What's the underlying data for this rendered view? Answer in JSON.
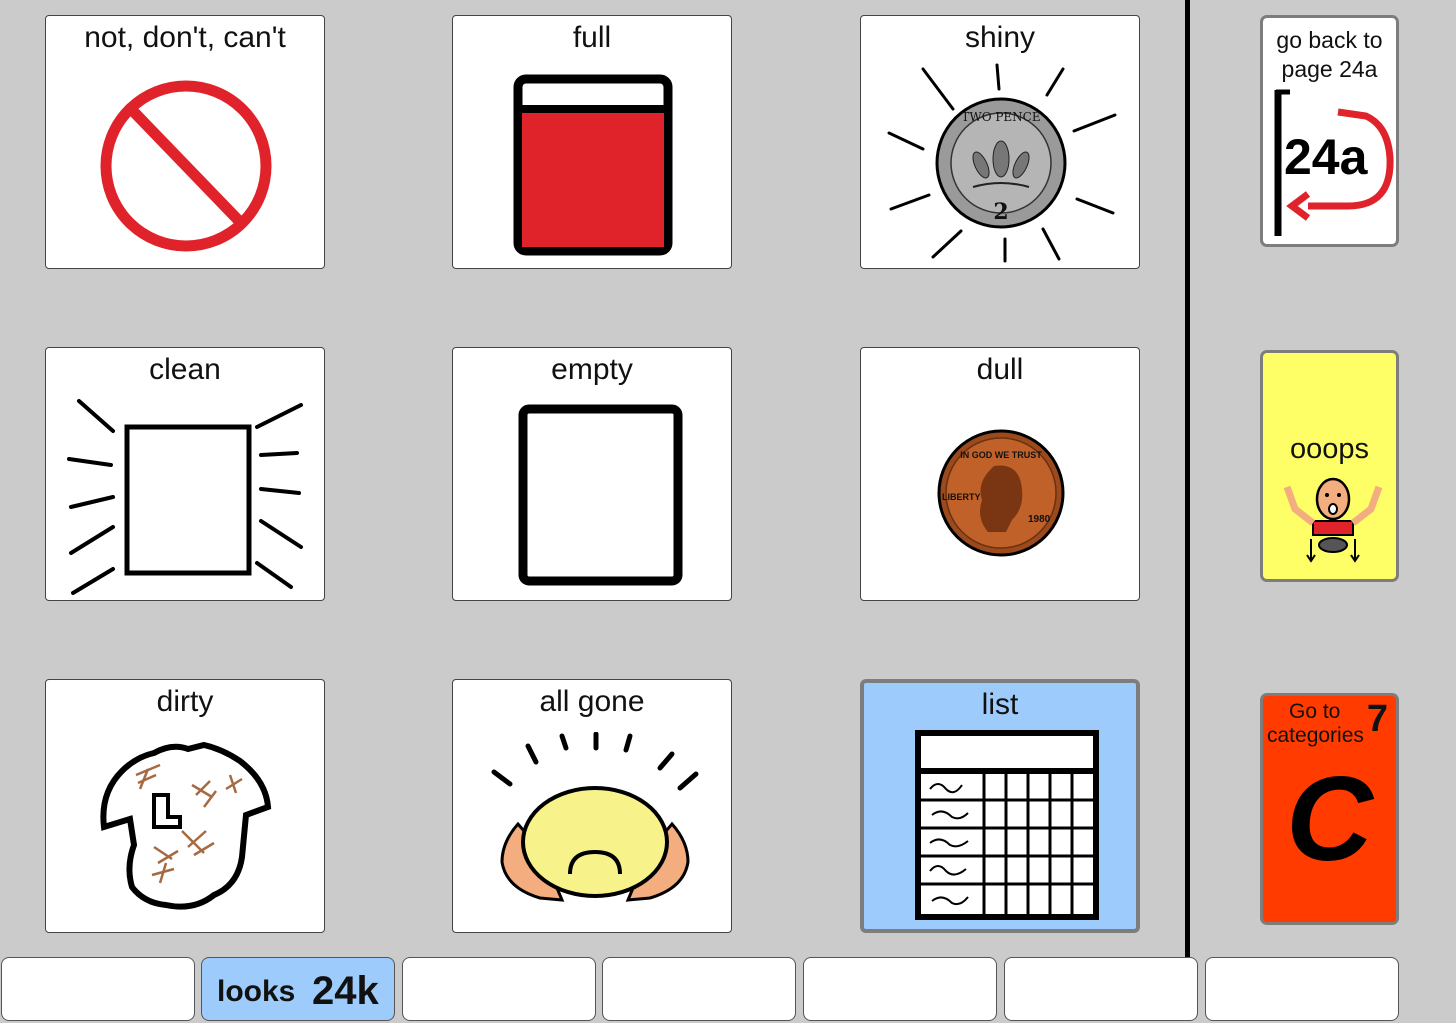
{
  "grid": {
    "cells": [
      {
        "label": "not, don't, can't",
        "icon": "no-symbol-icon"
      },
      {
        "label": "full",
        "icon": "full-container-icon"
      },
      {
        "label": "shiny",
        "icon": "shiny-coin-icon"
      },
      {
        "label": "clean",
        "icon": "clean-box-icon"
      },
      {
        "label": "empty",
        "icon": "empty-container-icon"
      },
      {
        "label": "dull",
        "icon": "dull-penny-icon"
      },
      {
        "label": "dirty",
        "icon": "dirty-shirt-icon"
      },
      {
        "label": "all gone",
        "icon": "empty-bowl-icon"
      },
      {
        "label": "list",
        "icon": "list-table-icon"
      }
    ],
    "coin_text": {
      "shiny_top": "TWO PENCE",
      "shiny_value": "2",
      "dull_motto": "IN GOD WE TRUST",
      "dull_liberty": "LIBERTY",
      "dull_year": "1980"
    }
  },
  "side": {
    "back": {
      "label_line1": "go back to",
      "label_line2": "page 24a",
      "page": "24a"
    },
    "oops": {
      "label": "ooops"
    },
    "categories": {
      "line1": "Go to",
      "line2": "categories",
      "number": "7",
      "letter": "C"
    }
  },
  "tabs": [
    {
      "label": "",
      "code": ""
    },
    {
      "label": "looks",
      "code": "24k"
    },
    {
      "label": "",
      "code": ""
    },
    {
      "label": "",
      "code": ""
    },
    {
      "label": "",
      "code": ""
    },
    {
      "label": "",
      "code": ""
    },
    {
      "label": "",
      "code": ""
    }
  ],
  "colors": {
    "background": "#cbcbcb",
    "list_cell": "#9dcbfb",
    "oops": "#fefe66",
    "categories": "#ff3b00",
    "active_tab": "#9dcbfb"
  }
}
